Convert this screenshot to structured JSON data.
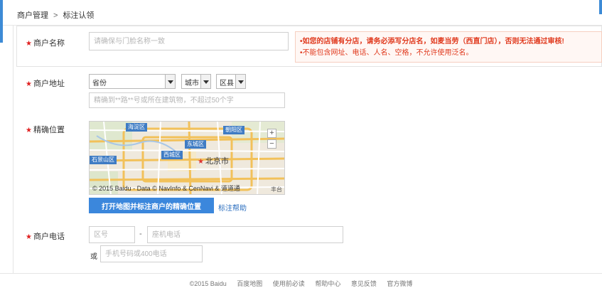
{
  "colors": {
    "accent": "#3d8bd6",
    "primary_button": "#3b87dc",
    "warning_text": "#e03a1e",
    "required_star": "#e02020",
    "link": "#2a6ebf"
  },
  "breadcrumb": {
    "root": "商户管理",
    "separator": ">",
    "current": "标注认领"
  },
  "form": {
    "name": {
      "label": "商户名称",
      "placeholder": "请确保与门脸名称一致"
    },
    "warning": {
      "line1": "•如您的店铺有分店，请务必添写分店名，如麦当劳（西直门店），否则无法通过审核!",
      "line2": "•不能包含网址、电话、人名、空格，不允许使用泛名。"
    },
    "address": {
      "label": "商户地址",
      "province": "省份",
      "city": "城市",
      "district": "区县",
      "detail_placeholder": "精确到**路**号或所在建筑物，不超过50个字"
    },
    "location": {
      "label": "精确位置",
      "map_city": "北京市",
      "districts": [
        "海淀区",
        "朝阳区",
        "东城区",
        "西城区",
        "石景山区",
        "丰台"
      ],
      "map_copyright": "© 2015 Baidu - Data © NavInfo & CenNavi & 道道通",
      "open_map_button": "打开地图并标注商户的精确位置",
      "help_link": "标注帮助",
      "zoom_in": "+",
      "zoom_out": "−"
    },
    "phone": {
      "label": "商户电话",
      "area_code_placeholder": "区号",
      "dash": "-",
      "landline_placeholder": "座机电话",
      "or_label": "或",
      "mobile_placeholder": "手机号码或400电话"
    }
  },
  "footer": {
    "copyright": "©2015 Baidu",
    "links": [
      "百度地图",
      "使用前必读",
      "帮助中心",
      "意见反馈",
      "官方微博"
    ]
  }
}
